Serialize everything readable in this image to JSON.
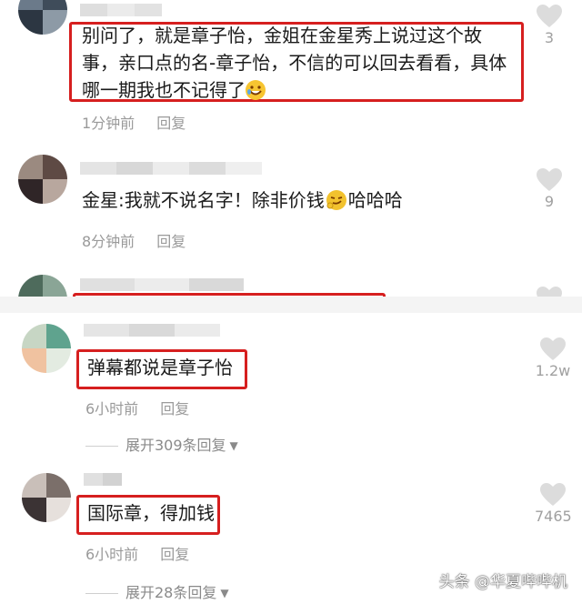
{
  "comments": [
    {
      "lines": [
        "别问了，就是章子怡，金姐在金星秀上说过这个故",
        "事，亲口点的名-章子怡，不信的可以回去看看，具体",
        "哪一期我也不记得了"
      ],
      "emoji": "rofl-emoji",
      "time": "1分钟前",
      "reply": "回复",
      "likes": "3"
    },
    {
      "text": "金星:我就不说名字！除非价钱",
      "text_after": "哈哈哈",
      "emoji": "smirk-emoji",
      "time": "8分钟前",
      "reply": "回复",
      "likes": "9"
    },
    {
      "text": "弹幕都说是章子怡",
      "time": "6小时前",
      "reply": "回复",
      "likes": "1.2w",
      "expand": "展开309条回复"
    },
    {
      "text": "国际章，得加钱",
      "time": "6小时前",
      "reply": "回复",
      "likes": "7465",
      "expand": "展开28条回复"
    }
  ],
  "watermark": "头条 @华夏哔哔机",
  "colors": {
    "highlight_border": "#d61f1f",
    "meta_text": "#9a9a9a",
    "heart": "#dcdcdc"
  }
}
